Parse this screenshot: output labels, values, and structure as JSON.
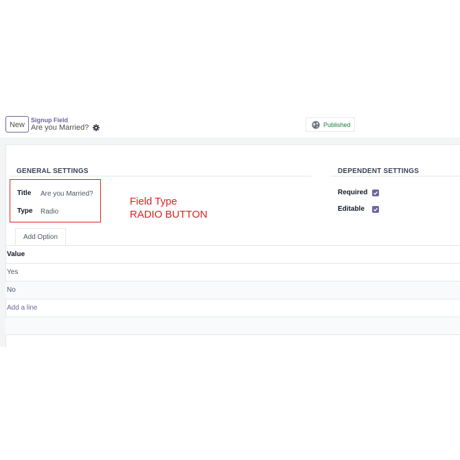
{
  "control_panel": {
    "new_label": "New",
    "breadcrumb_parent": "Signup Field",
    "record_name": "Are you Married?",
    "status_label": "Published",
    "status_icon": "globe-icon",
    "settings_icon": "gear-icon"
  },
  "general": {
    "title": "GENERAL SETTINGS",
    "fields": [
      {
        "label": "Title",
        "value": "Are you Married?"
      },
      {
        "label": "Type",
        "value": "Radio"
      }
    ]
  },
  "dependent": {
    "title": "DEPENDENT SETTINGS",
    "fields": [
      {
        "label": "Required",
        "checked": true
      },
      {
        "label": "Editable",
        "checked": true
      }
    ]
  },
  "annotation": {
    "line1": "Field Type",
    "line2": "RADIO BUTTON",
    "color": "#e11d1d"
  },
  "tabs": [
    {
      "label": "Add Option"
    }
  ],
  "options_list": {
    "header": "Value",
    "rows": [
      "Yes",
      "No"
    ],
    "add_line": "Add a line"
  },
  "colors": {
    "accent": "#71639e",
    "published": "#15803d"
  }
}
